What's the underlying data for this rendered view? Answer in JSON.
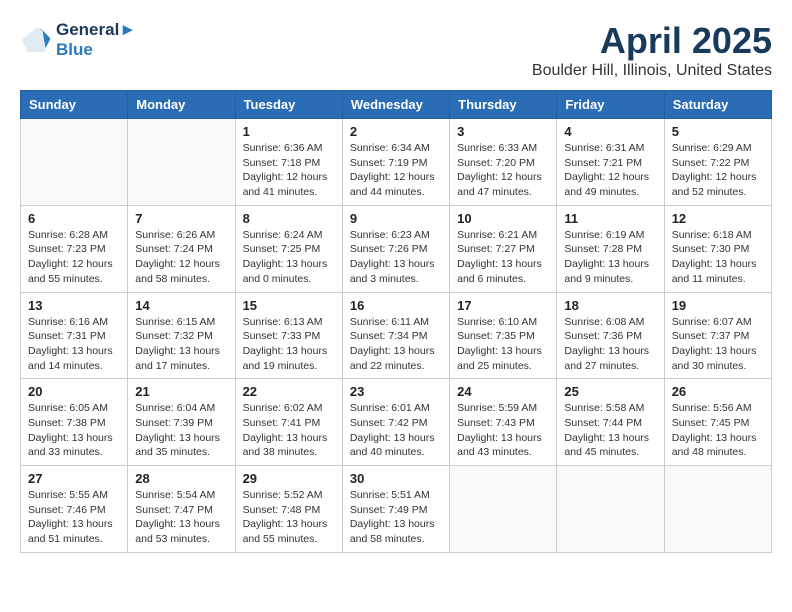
{
  "logo": {
    "line1": "General",
    "line2": "Blue"
  },
  "title": "April 2025",
  "subtitle": "Boulder Hill, Illinois, United States",
  "days_of_week": [
    "Sunday",
    "Monday",
    "Tuesday",
    "Wednesday",
    "Thursday",
    "Friday",
    "Saturday"
  ],
  "weeks": [
    [
      {
        "day": "",
        "sunrise": "",
        "sunset": "",
        "daylight": ""
      },
      {
        "day": "",
        "sunrise": "",
        "sunset": "",
        "daylight": ""
      },
      {
        "day": "1",
        "sunrise": "Sunrise: 6:36 AM",
        "sunset": "Sunset: 7:18 PM",
        "daylight": "Daylight: 12 hours and 41 minutes."
      },
      {
        "day": "2",
        "sunrise": "Sunrise: 6:34 AM",
        "sunset": "Sunset: 7:19 PM",
        "daylight": "Daylight: 12 hours and 44 minutes."
      },
      {
        "day": "3",
        "sunrise": "Sunrise: 6:33 AM",
        "sunset": "Sunset: 7:20 PM",
        "daylight": "Daylight: 12 hours and 47 minutes."
      },
      {
        "day": "4",
        "sunrise": "Sunrise: 6:31 AM",
        "sunset": "Sunset: 7:21 PM",
        "daylight": "Daylight: 12 hours and 49 minutes."
      },
      {
        "day": "5",
        "sunrise": "Sunrise: 6:29 AM",
        "sunset": "Sunset: 7:22 PM",
        "daylight": "Daylight: 12 hours and 52 minutes."
      }
    ],
    [
      {
        "day": "6",
        "sunrise": "Sunrise: 6:28 AM",
        "sunset": "Sunset: 7:23 PM",
        "daylight": "Daylight: 12 hours and 55 minutes."
      },
      {
        "day": "7",
        "sunrise": "Sunrise: 6:26 AM",
        "sunset": "Sunset: 7:24 PM",
        "daylight": "Daylight: 12 hours and 58 minutes."
      },
      {
        "day": "8",
        "sunrise": "Sunrise: 6:24 AM",
        "sunset": "Sunset: 7:25 PM",
        "daylight": "Daylight: 13 hours and 0 minutes."
      },
      {
        "day": "9",
        "sunrise": "Sunrise: 6:23 AM",
        "sunset": "Sunset: 7:26 PM",
        "daylight": "Daylight: 13 hours and 3 minutes."
      },
      {
        "day": "10",
        "sunrise": "Sunrise: 6:21 AM",
        "sunset": "Sunset: 7:27 PM",
        "daylight": "Daylight: 13 hours and 6 minutes."
      },
      {
        "day": "11",
        "sunrise": "Sunrise: 6:19 AM",
        "sunset": "Sunset: 7:28 PM",
        "daylight": "Daylight: 13 hours and 9 minutes."
      },
      {
        "day": "12",
        "sunrise": "Sunrise: 6:18 AM",
        "sunset": "Sunset: 7:30 PM",
        "daylight": "Daylight: 13 hours and 11 minutes."
      }
    ],
    [
      {
        "day": "13",
        "sunrise": "Sunrise: 6:16 AM",
        "sunset": "Sunset: 7:31 PM",
        "daylight": "Daylight: 13 hours and 14 minutes."
      },
      {
        "day": "14",
        "sunrise": "Sunrise: 6:15 AM",
        "sunset": "Sunset: 7:32 PM",
        "daylight": "Daylight: 13 hours and 17 minutes."
      },
      {
        "day": "15",
        "sunrise": "Sunrise: 6:13 AM",
        "sunset": "Sunset: 7:33 PM",
        "daylight": "Daylight: 13 hours and 19 minutes."
      },
      {
        "day": "16",
        "sunrise": "Sunrise: 6:11 AM",
        "sunset": "Sunset: 7:34 PM",
        "daylight": "Daylight: 13 hours and 22 minutes."
      },
      {
        "day": "17",
        "sunrise": "Sunrise: 6:10 AM",
        "sunset": "Sunset: 7:35 PM",
        "daylight": "Daylight: 13 hours and 25 minutes."
      },
      {
        "day": "18",
        "sunrise": "Sunrise: 6:08 AM",
        "sunset": "Sunset: 7:36 PM",
        "daylight": "Daylight: 13 hours and 27 minutes."
      },
      {
        "day": "19",
        "sunrise": "Sunrise: 6:07 AM",
        "sunset": "Sunset: 7:37 PM",
        "daylight": "Daylight: 13 hours and 30 minutes."
      }
    ],
    [
      {
        "day": "20",
        "sunrise": "Sunrise: 6:05 AM",
        "sunset": "Sunset: 7:38 PM",
        "daylight": "Daylight: 13 hours and 33 minutes."
      },
      {
        "day": "21",
        "sunrise": "Sunrise: 6:04 AM",
        "sunset": "Sunset: 7:39 PM",
        "daylight": "Daylight: 13 hours and 35 minutes."
      },
      {
        "day": "22",
        "sunrise": "Sunrise: 6:02 AM",
        "sunset": "Sunset: 7:41 PM",
        "daylight": "Daylight: 13 hours and 38 minutes."
      },
      {
        "day": "23",
        "sunrise": "Sunrise: 6:01 AM",
        "sunset": "Sunset: 7:42 PM",
        "daylight": "Daylight: 13 hours and 40 minutes."
      },
      {
        "day": "24",
        "sunrise": "Sunrise: 5:59 AM",
        "sunset": "Sunset: 7:43 PM",
        "daylight": "Daylight: 13 hours and 43 minutes."
      },
      {
        "day": "25",
        "sunrise": "Sunrise: 5:58 AM",
        "sunset": "Sunset: 7:44 PM",
        "daylight": "Daylight: 13 hours and 45 minutes."
      },
      {
        "day": "26",
        "sunrise": "Sunrise: 5:56 AM",
        "sunset": "Sunset: 7:45 PM",
        "daylight": "Daylight: 13 hours and 48 minutes."
      }
    ],
    [
      {
        "day": "27",
        "sunrise": "Sunrise: 5:55 AM",
        "sunset": "Sunset: 7:46 PM",
        "daylight": "Daylight: 13 hours and 51 minutes."
      },
      {
        "day": "28",
        "sunrise": "Sunrise: 5:54 AM",
        "sunset": "Sunset: 7:47 PM",
        "daylight": "Daylight: 13 hours and 53 minutes."
      },
      {
        "day": "29",
        "sunrise": "Sunrise: 5:52 AM",
        "sunset": "Sunset: 7:48 PM",
        "daylight": "Daylight: 13 hours and 55 minutes."
      },
      {
        "day": "30",
        "sunrise": "Sunrise: 5:51 AM",
        "sunset": "Sunset: 7:49 PM",
        "daylight": "Daylight: 13 hours and 58 minutes."
      },
      {
        "day": "",
        "sunrise": "",
        "sunset": "",
        "daylight": ""
      },
      {
        "day": "",
        "sunrise": "",
        "sunset": "",
        "daylight": ""
      },
      {
        "day": "",
        "sunrise": "",
        "sunset": "",
        "daylight": ""
      }
    ]
  ]
}
